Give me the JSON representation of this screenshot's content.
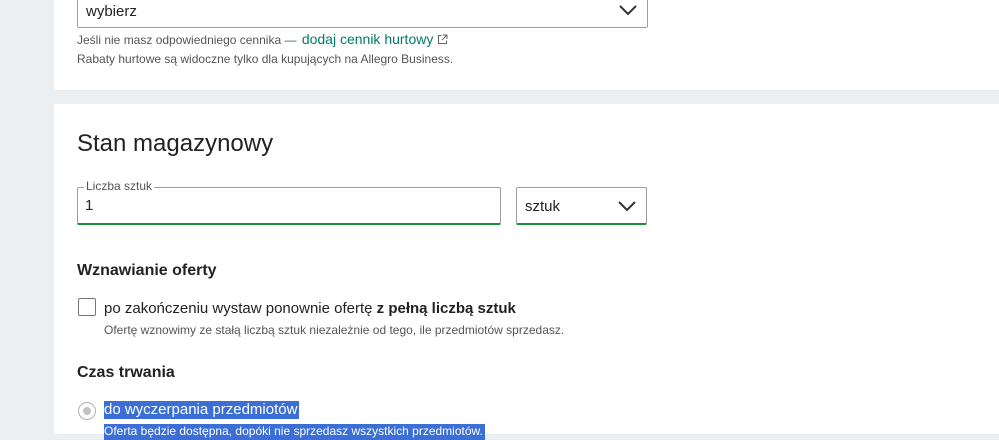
{
  "wholesale": {
    "select_value": "wybierz",
    "hint_text": "Jeśli nie masz odpowiedniego cennika —",
    "link_label": "dodaj cennik hurtowy",
    "note": "Rabaty hurtowe są widoczne tylko dla kupujących na Allegro Business."
  },
  "stock": {
    "title": "Stan magazynowy",
    "quantity_label": "Liczba sztuk",
    "quantity_value": "1",
    "unit_value": "sztuk"
  },
  "renewal": {
    "title": "Wznawianie oferty",
    "checkbox_label_prefix": "po zakończeniu wystaw ponownie ofertę",
    "checkbox_label_bold": "z pełną liczbą sztuk",
    "checkbox_description": "Ofertę wznowimy ze stałą liczbą sztuk niezależnie od tego, ile przedmiotów sprzedasz."
  },
  "duration": {
    "title": "Czas trwania",
    "option_label": "do wyczerpania przedmiotów",
    "option_description": "Oferta będzie dostępna, dopóki nie sprzedasz wszystkich przedmiotów."
  },
  "colors": {
    "accent_green": "#1a8f3a",
    "link": "#00796b",
    "selection": "#3b6fd6"
  }
}
